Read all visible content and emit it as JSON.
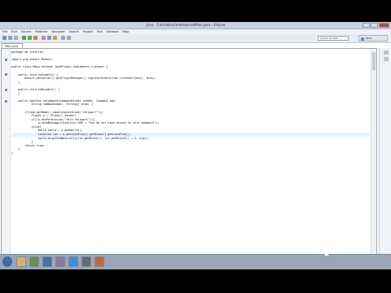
{
  "window": {
    "title": "Java - Tutorial/src/me/tutorial/Main.java - Eclipse"
  },
  "menubar": {
    "items": [
      "File",
      "Edit",
      "Source",
      "Refactor",
      "Navigate",
      "Search",
      "Project",
      "Run",
      "Window",
      "Help"
    ]
  },
  "toolbar": {
    "quick_access_placeholder": "Quick Access",
    "perspective_label": "Java"
  },
  "editor": {
    "tab_label": "Main.java",
    "lines": [
      {
        "text": "package me.tutorial;",
        "marker": false
      },
      {
        "text": "",
        "marker": false
      },
      {
        "text": "import org.bukkit.Bukkit;",
        "marker": true
      },
      {
        "text": "",
        "marker": false
      },
      {
        "text": "public class Main extends JavaPlugin implements Listener {",
        "marker": false
      },
      {
        "text": "",
        "marker": false
      },
      {
        "text": "    public void onEnable() {",
        "marker": true
      },
      {
        "text": "        Bukkit.getServer().getPluginManager().registerEvents(new Listener(this), this);",
        "marker": false
      },
      {
        "text": "    }",
        "marker": false
      },
      {
        "text": "",
        "marker": false
      },
      {
        "text": "    public void onDisable() {",
        "marker": true
      },
      {
        "text": "    }",
        "marker": false
      },
      {
        "text": "",
        "marker": false
      },
      {
        "text": "    public boolean onCommand(CommandSender sender, Command cmd,",
        "marker": true
      },
      {
        "text": "            String commandLabel, String[] args) {",
        "marker": false
      },
      {
        "text": "",
        "marker": false
      },
      {
        "text": "        if(cmd.getName().equalsIgnoreCase(\"teleport\")){",
        "marker": false
      },
      {
        "text": "            Player p = (Player) sender;",
        "marker": false
      },
      {
        "text": "            if(!p.hasPermission(\"tele.teleport\")){",
        "marker": false
      },
      {
        "text": "                p.sendMessage(ChatColor.RED + \"You do not have access to this command!\");",
        "marker": false
      },
      {
        "text": "            }else{",
        "marker": false
      },
      {
        "text": "                World world = p.getWorld();",
        "marker": false
      },
      {
        "text": "                Location loc = p.getLocation().getBlock().getLocation();",
        "marker": false
      },
      {
        "text": "                world.dropItemNaturally(loc.getBlock(), loc.getBlockY() + 2, args);",
        "marker": false
      },
      {
        "text": "            }",
        "marker": false
      },
      {
        "text": "        return true;",
        "marker": false
      },
      {
        "text": "    }",
        "marker": false
      },
      {
        "text": "}",
        "marker": false
      }
    ],
    "current_line_index": 22
  },
  "taskbar": {
    "clock": ""
  }
}
